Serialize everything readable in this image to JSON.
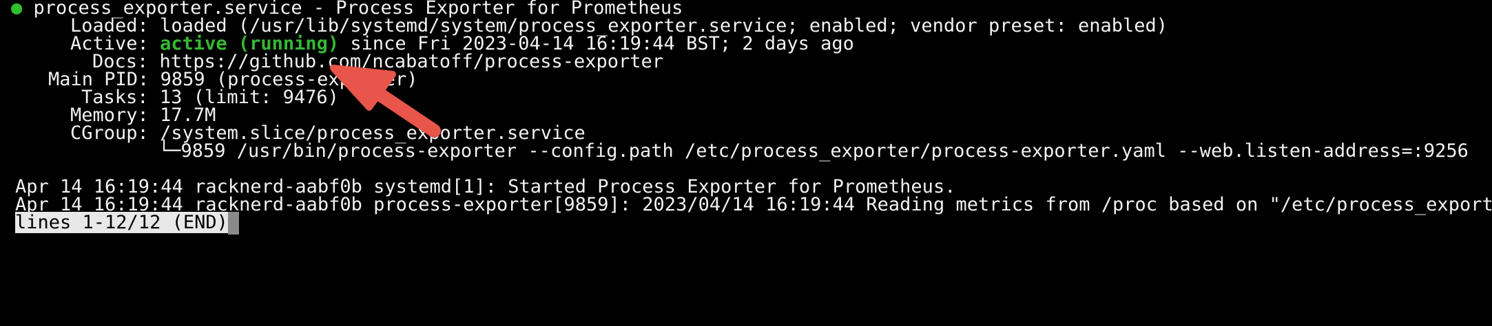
{
  "unit": {
    "status_dot": "●",
    "header": "process_exporter.service - Process Exporter for Prometheus",
    "loaded_label": "Loaded:",
    "loaded_value": "loaded (/usr/lib/systemd/system/process_exporter.service; enabled; vendor preset: enabled)",
    "active_label": "Active:",
    "active_status": "active (running)",
    "active_rest": " since Fri 2023-04-14 16:19:44 BST; 2 days ago",
    "docs_label": "Docs:",
    "docs_value": "https://github.com/ncabatoff/process-exporter",
    "mainpid_label": "Main PID:",
    "mainpid_value": "9859 (process-exporter)",
    "tasks_label": "Tasks:",
    "tasks_value": "13 (limit: 9476)",
    "memory_label": "Memory:",
    "memory_value": "17.7M",
    "cgroup_label": "CGroup:",
    "cgroup_value": "/system.slice/process_exporter.service",
    "cgroup_child": "└─9859 /usr/bin/process-exporter --config.path /etc/process_exporter/process-exporter.yaml --web.listen-address=:9256"
  },
  "logs": [
    "Apr 14 16:19:44 racknerd-aabf0b systemd[1]: Started Process Exporter for Prometheus.",
    "Apr 14 16:19:44 racknerd-aabf0b process-exporter[9859]: 2023/04/14 16:19:44 Reading metrics from /proc based on \"/etc/process_export"
  ],
  "overflow_marker": ">",
  "pager": {
    "status": "lines 1-12/12 (END)"
  },
  "colors": {
    "background": "#000000",
    "text": "#f2f2f2",
    "active_green": "#36b834",
    "annotation_arrow": "#e8554a"
  },
  "annotation": {
    "icon": "arrow-icon"
  }
}
